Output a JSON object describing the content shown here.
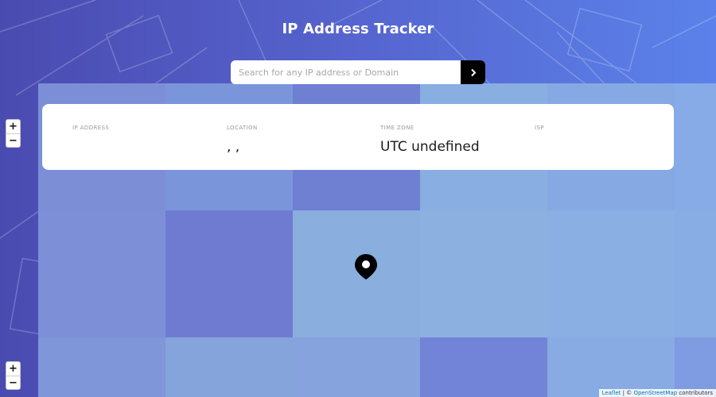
{
  "header": {
    "title": "IP Address Tracker"
  },
  "search": {
    "placeholder": "Search for any IP address or Domain",
    "value": ""
  },
  "info": {
    "ip_label": "IP ADDRESS",
    "ip_value": "",
    "location_label": "LOCATION",
    "location_value": ", ,",
    "timezone_label": "TIME ZONE",
    "timezone_value": "UTC undefined",
    "isp_label": "ISP",
    "isp_value": ""
  },
  "zoom": {
    "in_label": "+",
    "out_label": "−"
  },
  "attribution": {
    "leaflet": "Leaflet",
    "separator": " | © ",
    "osm": "OpenStreetMap",
    "suffix": " contributors"
  },
  "colors": {
    "header_start": "#4a4bb0",
    "header_end": "#5b82ea",
    "button": "#000000",
    "card": "#ffffff"
  },
  "icons": {
    "search_button": "chevron-right-icon",
    "marker": "location-pin-icon"
  }
}
